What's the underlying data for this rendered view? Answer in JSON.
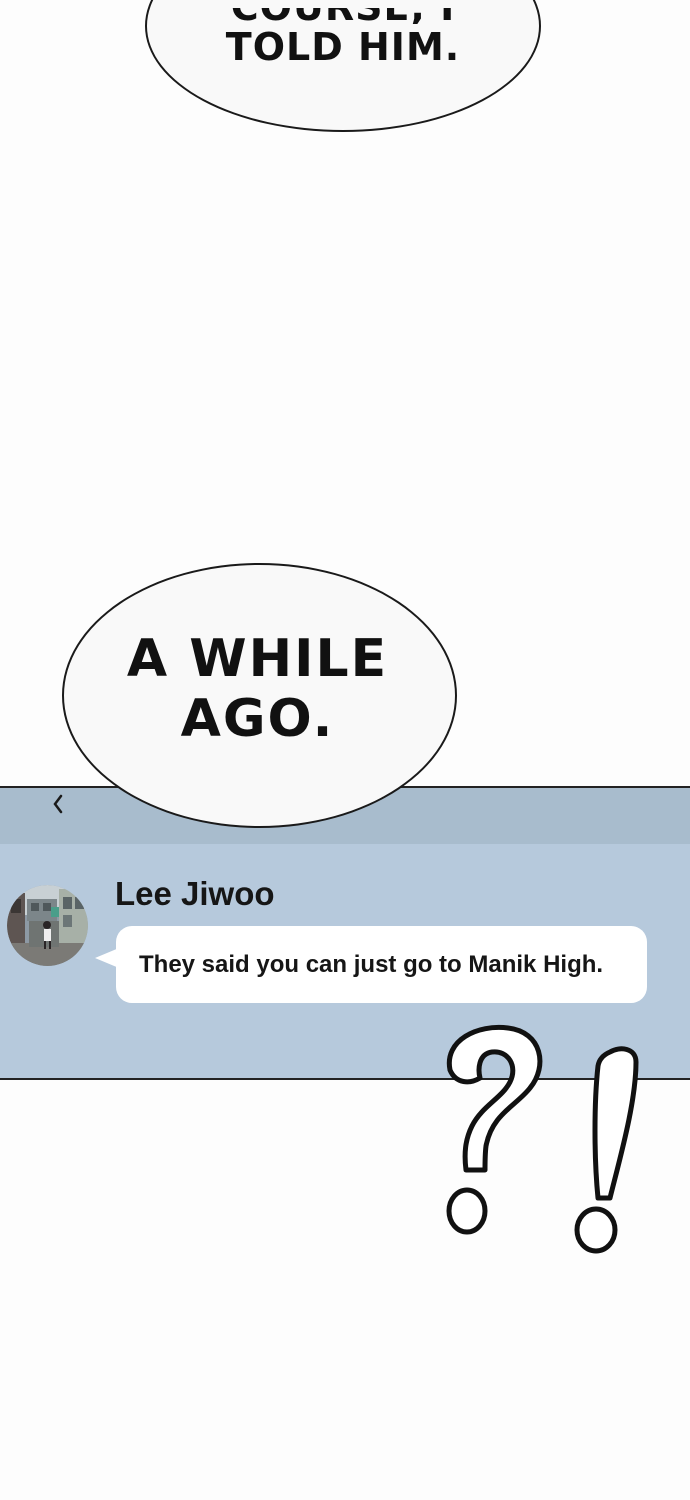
{
  "bubble_top": {
    "cut_line": "COURSE, I",
    "line": "TOLD HIM."
  },
  "bubble_mid": {
    "line1": "A WHILE",
    "line2": "AGO."
  },
  "chat": {
    "sender": "Lee Jiwoo",
    "message": "They said you can just go to Manik High.",
    "header_icon": "chevron-left-icon",
    "avatar_icon": "profile-photo",
    "colors": {
      "panel": "#b6c9dc",
      "header": "#a8bccd",
      "bubble": "#ffffff"
    }
  },
  "reaction": {
    "icon": "question-exclamation-marks"
  }
}
